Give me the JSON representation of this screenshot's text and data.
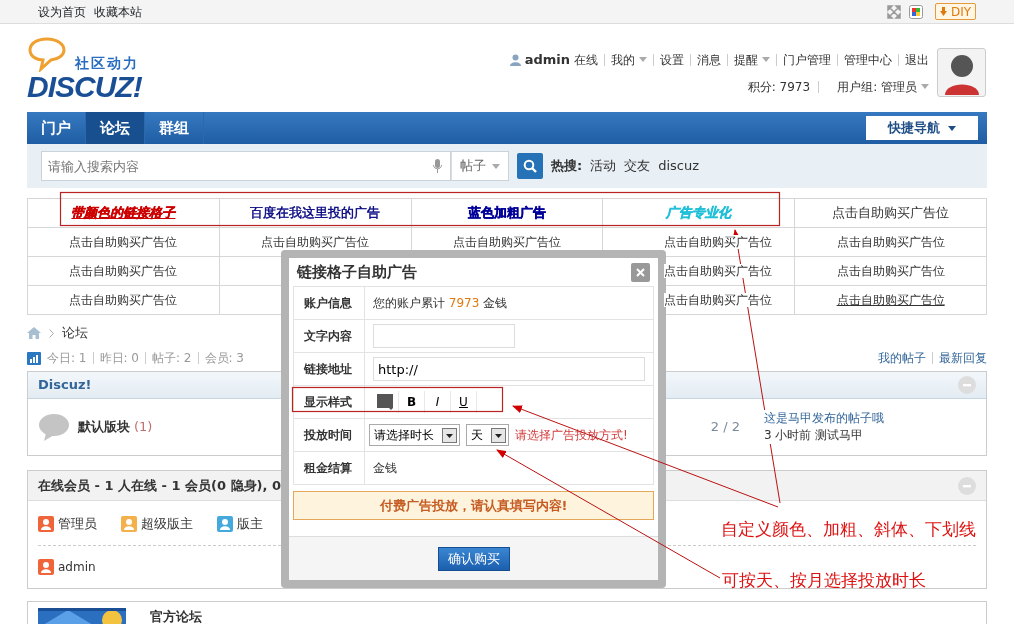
{
  "top_bar": {
    "links": [
      "设为首页",
      "收藏本站"
    ],
    "diy_button": "DIY"
  },
  "header": {
    "logo": {
      "tagline": "社区动力",
      "wordmark": "DISCUZ!"
    },
    "user": {
      "name": "admin",
      "status": "在线"
    },
    "user_menu": [
      {
        "label": "我的",
        "dropdown": true
      },
      {
        "label": "设置",
        "dropdown": false
      },
      {
        "label": "消息",
        "dropdown": false
      },
      {
        "label": "提醒",
        "dropdown": true
      },
      {
        "label": "门户管理",
        "dropdown": false
      },
      {
        "label": "管理中心",
        "dropdown": false
      },
      {
        "label": "退出",
        "dropdown": false
      }
    ],
    "points": "积分: 7973",
    "usergroup": "用户组: 管理员"
  },
  "nav": {
    "items": [
      {
        "label": "门户",
        "selected": false
      },
      {
        "label": "论坛",
        "selected": true
      },
      {
        "label": "群组",
        "selected": false
      }
    ],
    "quick_nav": "快捷导航"
  },
  "search": {
    "placeholder": "请输入搜索内容",
    "scope": "帖子",
    "hot_label": "热搜:",
    "hot": [
      "活动",
      "交友",
      "discuz"
    ]
  },
  "ad_grid": {
    "rows": [
      {
        "cells": [
          {
            "text": "带颜色的链接格子",
            "color": "#cc0000",
            "bold": true,
            "italic": true,
            "underline": true
          },
          {
            "text": "百度在我这里投的广告",
            "color": "#000080"
          },
          {
            "text": "蓝色加粗广告",
            "color": "#000099",
            "bold": true
          },
          {
            "text": "广告专业化",
            "color": "#22c0d8",
            "bold": true,
            "italic": true
          },
          {
            "text": "点击自助购买广告位"
          }
        ]
      },
      {
        "cells": [
          {
            "text": "点击自助购买广告位"
          },
          {
            "text": "点击自助购买广告位"
          },
          {
            "text": "点击自助购买广告位"
          },
          {
            "text": "点击自助购买广告位"
          },
          {
            "text": "点击自助购买广告位"
          }
        ]
      },
      {
        "cells": [
          {
            "text": "点击自助购买广告位"
          },
          {},
          {},
          {
            "text": "点击自助购买广告位"
          },
          {
            "text": "点击自助购买广告位"
          }
        ]
      },
      {
        "cells": [
          {
            "text": "点击自助购买广告位"
          },
          {},
          {},
          {
            "text": "点击自助购买广告位"
          },
          {
            "text": "点击自助购买广告位",
            "underline": true
          }
        ]
      }
    ]
  },
  "breadcrumb": [
    "论坛"
  ],
  "stats": [
    {
      "label": "今日:",
      "value": "1"
    },
    {
      "label": "昨日:",
      "value": "0"
    },
    {
      "label": "帖子:",
      "value": "2"
    },
    {
      "label": "会员:",
      "value": "3"
    }
  ],
  "my_links": [
    "我的帖子",
    "最新回复"
  ],
  "forum_group": {
    "title": "Discuz!",
    "forums": [
      {
        "name": "默认版块",
        "count": "(1)",
        "ratio": "2 / 2",
        "last_post": "这是马甲发布的帖子哦",
        "last_meta": "3 小时前 测试马甲"
      }
    ]
  },
  "online": {
    "title": "在线会员 - 1 人在线 - 1 会员(0 隐身), 0",
    "legend": [
      {
        "label": "管理员",
        "color": "#f0643a"
      },
      {
        "label": "超级版主",
        "color": "#f4b04a"
      },
      {
        "label": "版主",
        "color": "#45a9dd"
      }
    ],
    "users": [
      {
        "name": "admin",
        "color": "#f0643a"
      }
    ]
  },
  "official": {
    "title": "官方论坛"
  },
  "dialog": {
    "title": "链接格子自助广告",
    "rows": [
      {
        "label": "账户信息",
        "kind": "account",
        "prefix": "您的账户累计",
        "amount": "7973",
        "suffix": "金钱"
      },
      {
        "label": "文字内容",
        "kind": "input"
      },
      {
        "label": "链接地址",
        "kind": "input",
        "value": "http://"
      },
      {
        "label": "显示样式",
        "kind": "style",
        "buttons": [
          "B",
          "I",
          "U"
        ]
      },
      {
        "label": "投放时间",
        "kind": "selects",
        "selects": [
          "请选择时长",
          "天"
        ],
        "hint": "请选择广告投放方式!"
      },
      {
        "label": "租金结算",
        "kind": "text",
        "value": "金钱"
      }
    ],
    "notice": "付费广告投放，请认真填写内容!",
    "submit": "确认购买"
  },
  "annotations": [
    {
      "text": "自定义颜色、加粗、斜体、下划线"
    },
    {
      "text": "可按天、按月选择投放时长"
    }
  ]
}
